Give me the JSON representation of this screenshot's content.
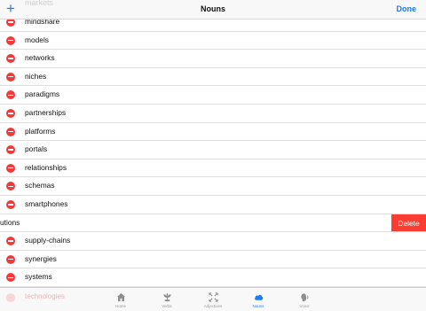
{
  "navbar": {
    "title": "Nouns",
    "done_label": "Done",
    "add_label": "+",
    "ghost_item": "markets"
  },
  "rows": [
    {
      "label": "mindshare"
    },
    {
      "label": "models"
    },
    {
      "label": "networks"
    },
    {
      "label": "niches"
    },
    {
      "label": "paradigms"
    },
    {
      "label": "partnerships"
    },
    {
      "label": "platforms"
    },
    {
      "label": "portals"
    },
    {
      "label": "relationships"
    },
    {
      "label": "schemas"
    },
    {
      "label": "smartphones"
    },
    {
      "label": "utions",
      "delete_label": "Delete"
    },
    {
      "label": "supply-chains"
    },
    {
      "label": "synergies"
    },
    {
      "label": "systems"
    }
  ],
  "tabbar": {
    "ghost_item": "technologies",
    "tabs": [
      {
        "label": "Home",
        "icon": "house-icon"
      },
      {
        "label": "Verbs",
        "icon": "plant-icon"
      },
      {
        "label": "Adjectives",
        "icon": "arrows-icon"
      },
      {
        "label": "Nouns",
        "icon": "cloud-icon"
      },
      {
        "label": "Voice",
        "icon": "speaker-icon"
      }
    ]
  },
  "colors": {
    "accent": "#1b7cf4",
    "delete_red": "#fb3c31",
    "minus_red": "#ef3b3b"
  }
}
